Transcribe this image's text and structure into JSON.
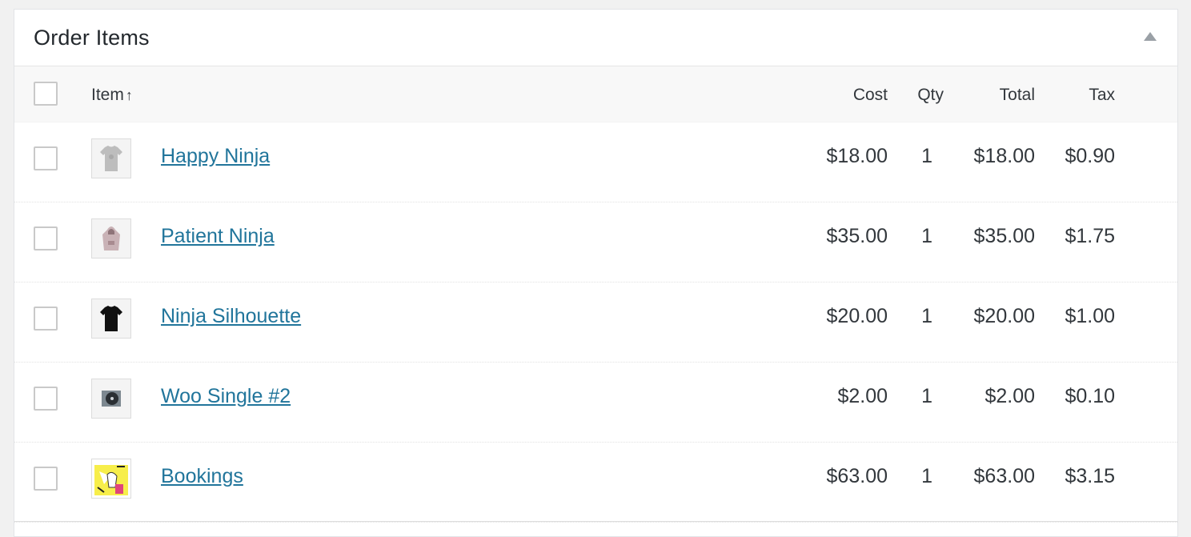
{
  "panel": {
    "title": "Order Items"
  },
  "columns": {
    "item": "Item",
    "sort_arrow": "↑",
    "cost": "Cost",
    "qty": "Qty",
    "total": "Total",
    "tax": "Tax"
  },
  "items": [
    {
      "name": "Happy Ninja",
      "cost": "$18.00",
      "qty": "1",
      "total": "$18.00",
      "tax": "$0.90",
      "thumb_icon": "grey-tshirt-icon"
    },
    {
      "name": "Patient Ninja",
      "cost": "$35.00",
      "qty": "1",
      "total": "$35.00",
      "tax": "$1.75",
      "thumb_icon": "hoodie-icon"
    },
    {
      "name": "Ninja Silhouette",
      "cost": "$20.00",
      "qty": "1",
      "total": "$20.00",
      "tax": "$1.00",
      "thumb_icon": "black-tshirt-icon"
    },
    {
      "name": "Woo Single #2",
      "cost": "$2.00",
      "qty": "1",
      "total": "$2.00",
      "tax": "$0.10",
      "thumb_icon": "album-icon"
    },
    {
      "name": "Bookings",
      "cost": "$63.00",
      "qty": "1",
      "total": "$63.00",
      "tax": "$3.15",
      "thumb_icon": "bookings-poster-icon"
    }
  ],
  "colors": {
    "link": "#21759b",
    "text": "#32373c",
    "header_bg": "#f8f8f8"
  }
}
